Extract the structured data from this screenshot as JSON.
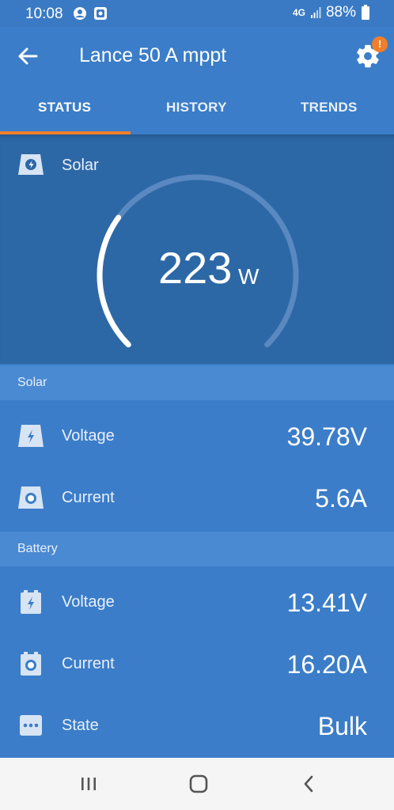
{
  "status_bar": {
    "time": "10:08",
    "network": "4G",
    "battery": "88%"
  },
  "app_bar": {
    "title": "Lance 50 A mppt",
    "badge": "!"
  },
  "tabs": [
    {
      "label": "STATUS",
      "active": true
    },
    {
      "label": "HISTORY",
      "active": false
    },
    {
      "label": "TRENDS",
      "active": false
    }
  ],
  "gauge": {
    "label": "Solar",
    "value": "223",
    "unit": "W",
    "level": 0.3
  },
  "sections": {
    "solar": {
      "header": "Solar",
      "rows": [
        {
          "label": "Voltage",
          "value": "39.78V",
          "icon": "lightning-icon"
        },
        {
          "label": "Current",
          "value": "5.6A",
          "icon": "current-icon"
        }
      ]
    },
    "battery": {
      "header": "Battery",
      "rows": [
        {
          "label": "Voltage",
          "value": "13.41V",
          "icon": "battery-lightning-icon"
        },
        {
          "label": "Current",
          "value": "16.20A",
          "icon": "battery-current-icon"
        },
        {
          "label": "State",
          "value": "Bulk",
          "icon": "ellipsis-icon"
        }
      ]
    }
  },
  "colors": {
    "primary": "#3b7dc8",
    "panel": "#2d68a6",
    "section_header": "#4a8ad2",
    "accent": "#f07f29"
  }
}
